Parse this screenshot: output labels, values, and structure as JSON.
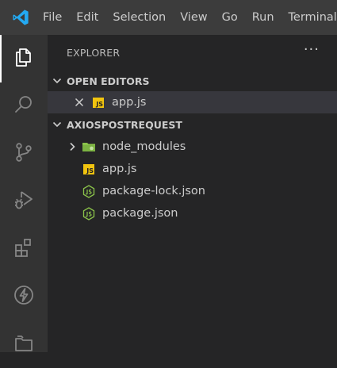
{
  "menu": {
    "items": [
      "File",
      "Edit",
      "Selection",
      "View",
      "Go",
      "Run",
      "Terminal"
    ]
  },
  "activity_bar": {
    "items": [
      {
        "icon": "explorer-icon",
        "active": true
      },
      {
        "icon": "search-icon",
        "active": false
      },
      {
        "icon": "source-control-icon",
        "active": false
      },
      {
        "icon": "run-debug-icon",
        "active": false
      },
      {
        "icon": "extensions-icon",
        "active": false
      },
      {
        "icon": "lightning-icon",
        "active": false
      },
      {
        "icon": "folder-icon",
        "active": false
      }
    ]
  },
  "explorer": {
    "title": "EXPLORER",
    "more_actions": "···"
  },
  "open_editors": {
    "title": "OPEN EDITORS",
    "files": [
      {
        "name": "app.js",
        "icon": "js-icon",
        "close_icon": "close-icon"
      }
    ]
  },
  "workspace": {
    "title": "AXIOSPOSTREQUEST",
    "items": [
      {
        "name": "node_modules",
        "type": "folder",
        "icon": "folder-icon"
      },
      {
        "name": "app.js",
        "type": "file",
        "icon": "js-icon"
      },
      {
        "name": "package-lock.json",
        "type": "file",
        "icon": "nodejs-icon"
      },
      {
        "name": "package.json",
        "type": "file",
        "icon": "nodejs-icon"
      }
    ]
  },
  "colors": {
    "titlebar": "#3c3c3c",
    "activitybar": "#333333",
    "sidebar": "#252526",
    "selection": "#37373d",
    "vscode_blue": "#23a9f2",
    "js_yellow": "#f1c40f",
    "node_green": "#8bc34a"
  }
}
